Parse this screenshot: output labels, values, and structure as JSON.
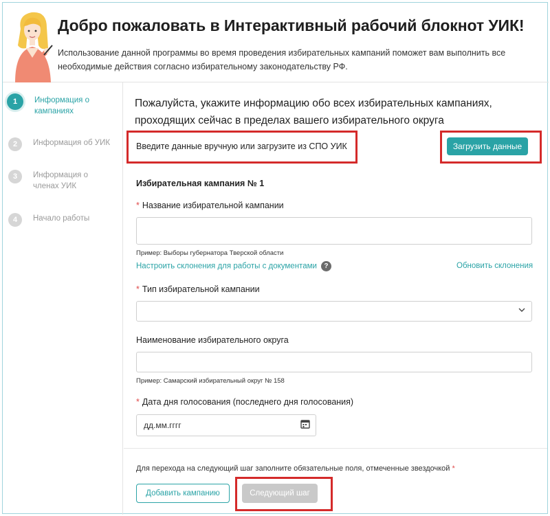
{
  "header": {
    "title": "Добро пожаловать в Интерактивный рабочий блокнот УИК!",
    "subtitle": "Использование данной программы во время проведения избирательных кампаний поможет вам выполнить все необходимые действия согласно избирательному законодательству РФ."
  },
  "sidebar": {
    "steps": [
      {
        "num": "1",
        "label": "Информация о кампаниях"
      },
      {
        "num": "2",
        "label": "Информация об УИК"
      },
      {
        "num": "3",
        "label": "Информация о членах УИК"
      },
      {
        "num": "4",
        "label": "Начало работы"
      }
    ]
  },
  "main": {
    "intro": "Пожалуйста, укажите информацию обо всех избирательных кампаниях, проходящих сейчас в пределах вашего избирательного округа",
    "manual_text": "Введите данные вручную или загрузите из СПО УИК",
    "load_button": "Загрузить данные",
    "section_title": "Избирательная кампания № 1",
    "campaign_name_label": "Название избирательной кампании",
    "campaign_name_hint": "Пример: Выборы губернатора Тверской области",
    "declension_link": "Настроить склонения для работы с документами",
    "help_icon": "?",
    "update_link": "Обновить склонения",
    "campaign_type_label": "Тип избирательной кампании",
    "district_label": "Наименование избирательного округа",
    "district_hint": "Пример: Самарский избирательный округ № 158",
    "vote_date_label": "Дата дня голосования (последнего дня голосования)",
    "date_placeholder": "дд.мм.гггг",
    "required_mark": "*",
    "footer_note": "Для перехода на следующий шаг заполните обязательные поля, отмеченные звездочкой",
    "add_campaign_button": "Добавить кампанию",
    "next_step_button": "Следующий шаг"
  },
  "colors": {
    "accent": "#2aa3a6",
    "highlight": "#d42a2a",
    "required": "#e04b4b",
    "disabled": "#c9c9c9"
  },
  "icons": [
    "avatar-illustration",
    "help-icon",
    "chevron-down-icon",
    "calendar-icon"
  ]
}
